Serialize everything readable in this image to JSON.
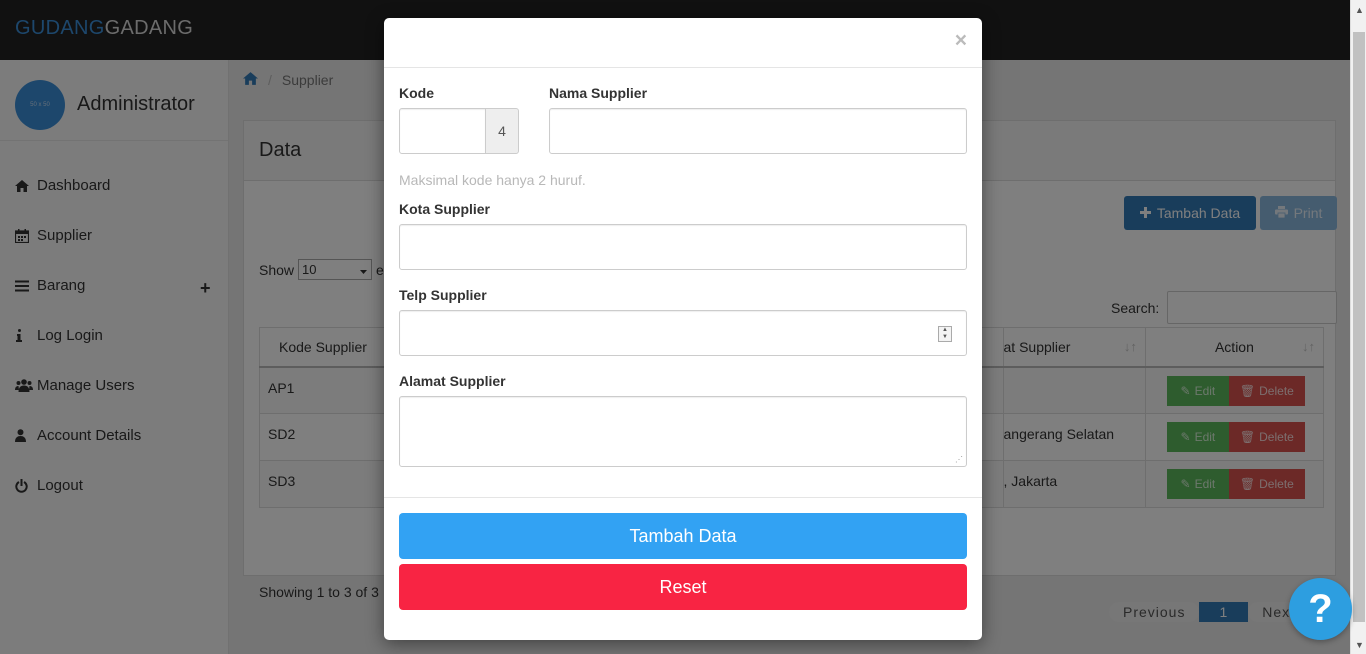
{
  "brand": {
    "part1": "GUDANG",
    "part2": "GADANG",
    "accent": "#3a8ed8"
  },
  "profile": {
    "avatar_text": "50 x 50",
    "name": "Administrator"
  },
  "sidebar": {
    "items": [
      {
        "label": "Dashboard",
        "icon": "home-icon"
      },
      {
        "label": "Supplier",
        "icon": "calendar-icon"
      },
      {
        "label": "Barang",
        "icon": "list-icon"
      },
      {
        "label": "Log Login",
        "icon": "info-icon"
      },
      {
        "label": "Manage Users",
        "icon": "users-icon"
      },
      {
        "label": "Account Details",
        "icon": "user-icon"
      },
      {
        "label": "Logout",
        "icon": "power-icon"
      }
    ],
    "expand_symbol": "+"
  },
  "breadcrumb": {
    "current": "Supplier"
  },
  "panel": {
    "title": "Data",
    "add_button": "Tambah Data",
    "print_button": "Print",
    "show_prefix": "Show",
    "show_value": "10",
    "show_suffix": "e",
    "search_label": "Search:",
    "showing_text": "Showing 1 to 3 of 3"
  },
  "table": {
    "headers": {
      "kode": "Kode Supplier",
      "alamat": "at Supplier",
      "action": "Action"
    },
    "rows": [
      {
        "kode": "AP1",
        "alamat": ""
      },
      {
        "kode": "SD2",
        "alamat": "angerang Selatan"
      },
      {
        "kode": "SD3",
        "alamat": ", Jakarta"
      }
    ],
    "edit_label": "Edit",
    "delete_label": "Delete"
  },
  "pager": {
    "previous": "Previous",
    "page": "1",
    "next": "Next"
  },
  "modal": {
    "close_symbol": "×",
    "kode_label": "Kode",
    "kode_value": "",
    "kode_addon": "4",
    "nama_label": "Nama Supplier",
    "nama_value": "",
    "kode_help": "Maksimal kode hanya 2 huruf.",
    "kota_label": "Kota Supplier",
    "kota_value": "",
    "telp_label": "Telp Supplier",
    "telp_value": "",
    "alamat_label": "Alamat Supplier",
    "alamat_value": "",
    "submit_button": "Tambah Data",
    "reset_button": "Reset"
  },
  "help": {
    "symbol": "?"
  },
  "colors": {
    "primary": "#337ab7",
    "submit": "#32a2f3",
    "reset": "#f82443",
    "edit": "#5cb85c",
    "delete": "#d9534f"
  }
}
